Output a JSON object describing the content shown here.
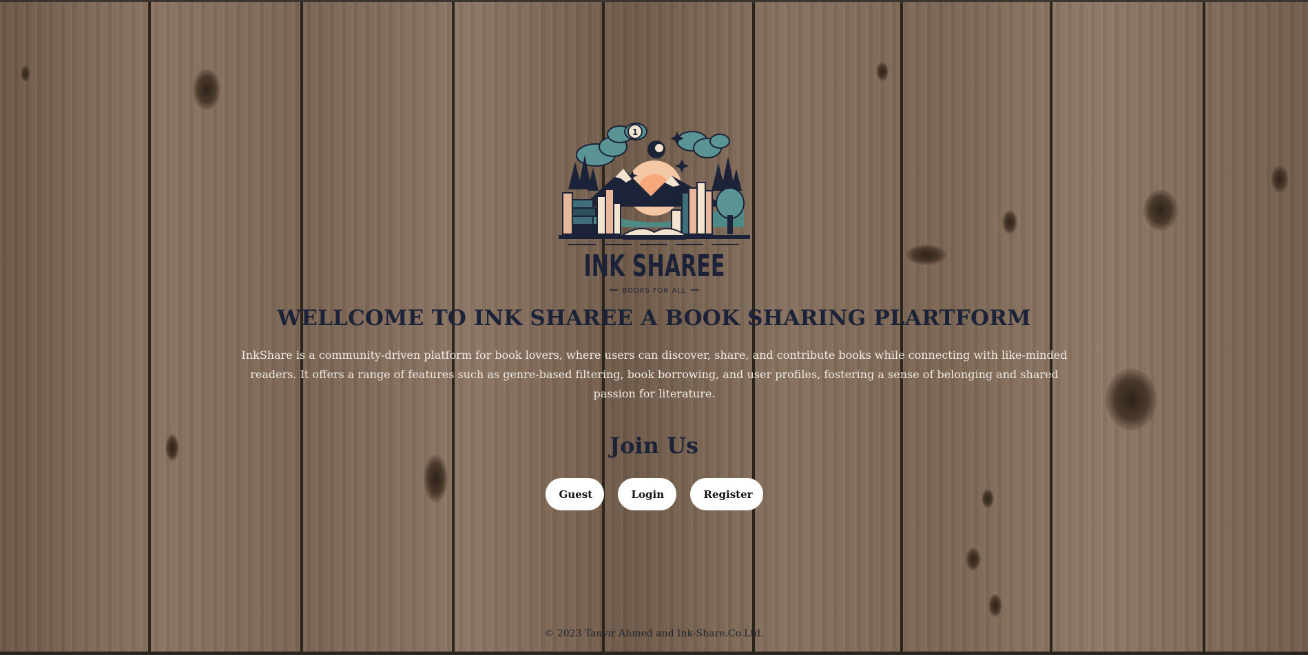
{
  "logo": {
    "wordmark": "INK SHAREE",
    "tagline": "BOOKS FOR ALL",
    "badge": "1"
  },
  "hero": {
    "headline": "WELLCOME TO INK SHAREE A BOOK SHARING PLARTFORM",
    "intro": "InkShare is a community-driven platform for book lovers, where users can discover, share, and contribute books while connecting with like-minded readers. It offers a range of features such as genre-based filtering, book borrowing, and user profiles, fostering a sense of belonging and shared passion for literature."
  },
  "join": {
    "title": "Join Us",
    "buttons": {
      "guest": "Guest",
      "login": "Login",
      "register": "Register"
    }
  },
  "footer": {
    "copyright": "© 2023 Tanvir Ahmed and Ink-Share.Co.Ltd."
  },
  "colors": {
    "wood": "#7a6350",
    "heading_navy": "#1c2338",
    "body_text": "#f1ebe4",
    "button_bg": "#ffffff"
  }
}
